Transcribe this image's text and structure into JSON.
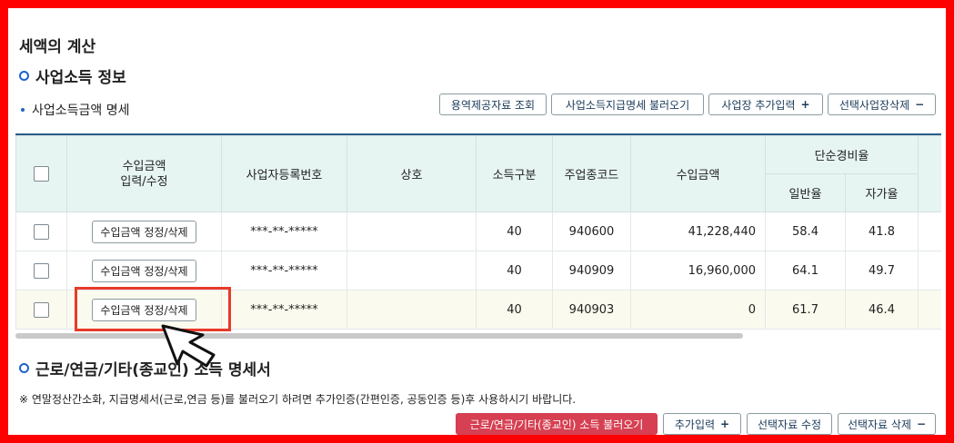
{
  "page": {
    "title": "세액의 계산"
  },
  "section1": {
    "title": "사업소득 정보",
    "subtitle": "사업소득금액 명세",
    "buttons": {
      "service_lookup": "용역제공자료 조회",
      "load_statement": "사업소득지급명세 불러오기",
      "add_business": "사업장 추가입력",
      "add_sign": "+",
      "delete_business": "선택사업장삭제",
      "delete_sign": "−"
    }
  },
  "table": {
    "headers": {
      "income_edit": "수입금액\n입력/수정",
      "reg_no": "사업자등록번호",
      "trade_name": "상호",
      "income_type": "소득구분",
      "industry_code": "주업종코드",
      "income_amount": "수입금액",
      "simple_rate": "단순경비율",
      "general_rate": "일반율",
      "self_rate": "자가율"
    },
    "rows": [
      {
        "edit_label": "수입금액 정정/삭제",
        "reg_no": "***-**-*****",
        "trade_name": "",
        "income_type": "40",
        "industry_code": "940600",
        "amount": "41,228,440",
        "general": "58.4",
        "self": "41.8"
      },
      {
        "edit_label": "수입금액 정정/삭제",
        "reg_no": "***-**-*****",
        "trade_name": "",
        "income_type": "40",
        "industry_code": "940909",
        "amount": "16,960,000",
        "general": "64.1",
        "self": "49.7"
      },
      {
        "edit_label": "수입금액 정정/삭제",
        "reg_no": "***-**-*****",
        "trade_name": "",
        "income_type": "40",
        "industry_code": "940903",
        "amount": "0",
        "general": "61.7",
        "self": "46.4"
      }
    ]
  },
  "section2": {
    "title": "근로/연금/기타(종교인) 소득 명세서",
    "note": "※ 연말정산간소화, 지급명세서(근로,연금 등)를 불러오기 하려면 추가인증(간편인증, 공동인증 등)후 사용하시기 바랍니다.",
    "buttons": {
      "load_income": "근로/연금/기타(종교인) 소득 불러오기",
      "add_input": "추가입력",
      "add_sign": "+",
      "edit_selected": "선택자료 수정",
      "delete_selected": "선택자료 삭제",
      "delete_sign": "−"
    }
  }
}
